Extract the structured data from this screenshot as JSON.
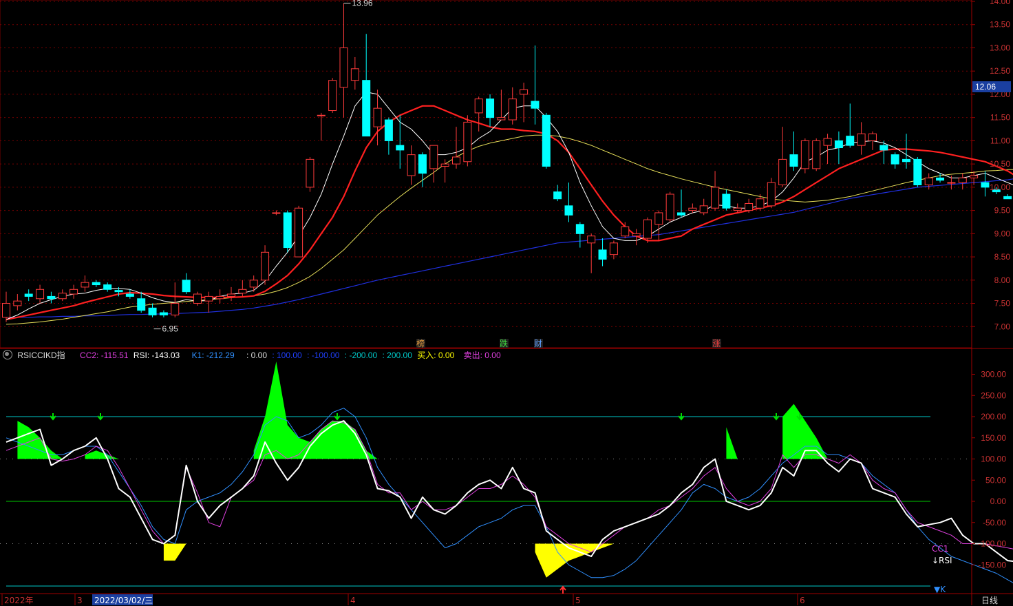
{
  "colors": {
    "bg": "#000000",
    "up": "#ff3b3b",
    "down": "#00ffff",
    "ma5": "#ffffff",
    "ma10": "#ff2020",
    "ma20": "#e8e05a",
    "ma60": "#2030e0",
    "grid": "#7a0000",
    "axis_text": "#c83232",
    "cc1_fill": "#00ff00",
    "cc1_fill_neg": "#ffff00",
    "cyan_line": "#00c8c8",
    "green_line": "#00c800",
    "magenta": "#e040e0",
    "blue_k": "#3090ff"
  },
  "price_axis": [
    "14.00",
    "13.50",
    "13.00",
    "12.50",
    "12.00",
    "11.50",
    "11.00",
    "10.50",
    "10.00",
    "9.50",
    "9.00",
    "8.50",
    "8.00",
    "7.50",
    "7.00"
  ],
  "current_price": "12.06",
  "high_label": "13.96",
  "low_label": "6.95",
  "indicator_axis": [
    "300.00",
    "250.00",
    "200.00",
    "150.00",
    "100.00",
    "50.00",
    "0.00",
    "-50.00",
    "-100.00",
    "-150.00"
  ],
  "indicator_header": {
    "name": "RSICCIKD指",
    "cc2": "CC2: -115.51",
    "rsi": "RSI: -143.03",
    "k1": "K1: -212.29",
    "v0": ": 0.00",
    "v100": ": 100.00",
    "vm100": ": -100.00",
    "vm200": ": -200.00",
    "v200": ": 200.00",
    "buy": "买入: 0.00",
    "sell": "卖出: 0.00"
  },
  "series_labels": {
    "cc1": "CC1",
    "rsi": "↓RSI",
    "k": "▼K"
  },
  "event_markers": [
    {
      "text": "榜",
      "color": "#e8a040"
    },
    {
      "text": "跌",
      "color": "#40e040"
    },
    {
      "text": "财",
      "color": "#60a0ff"
    },
    {
      "text": "涨",
      "color": "#ff4040"
    }
  ],
  "time_axis": {
    "labels": [
      "2022年",
      "3",
      "4",
      "5",
      "6"
    ],
    "cursor_date": "2022/03/02/三",
    "period": "日线"
  },
  "chart_data": {
    "type": "candlestick",
    "x_range": [
      "2022年",
      "6"
    ],
    "ylim": [
      6.9,
      14.0
    ],
    "candles": [
      [
        7.2,
        7.5,
        7.75,
        7.1
      ],
      [
        7.45,
        7.55,
        7.7,
        7.35
      ],
      [
        7.7,
        7.65,
        7.8,
        7.55
      ],
      [
        7.6,
        7.8,
        7.9,
        7.5
      ],
      [
        7.65,
        7.6,
        7.75,
        7.5
      ],
      [
        7.6,
        7.72,
        7.8,
        7.55
      ],
      [
        7.7,
        7.8,
        7.9,
        7.6
      ],
      [
        7.85,
        7.95,
        8.1,
        7.75
      ],
      [
        7.95,
        7.9,
        8.0,
        7.85
      ],
      [
        7.9,
        7.8,
        7.95,
        7.75
      ],
      [
        7.78,
        7.75,
        7.85,
        7.65
      ],
      [
        7.7,
        7.65,
        7.8,
        7.6
      ],
      [
        7.6,
        7.35,
        7.75,
        7.3
      ],
      [
        7.4,
        7.25,
        7.5,
        7.2
      ],
      [
        7.3,
        7.25,
        7.35,
        7.2
      ],
      [
        7.25,
        7.5,
        7.95,
        7.2
      ],
      [
        8.0,
        7.75,
        8.15,
        7.7
      ],
      [
        7.5,
        7.7,
        7.75,
        7.45
      ],
      [
        7.55,
        7.65,
        7.75,
        7.3
      ],
      [
        7.6,
        7.65,
        7.8,
        7.5
      ],
      [
        7.65,
        7.7,
        7.85,
        7.55
      ],
      [
        7.72,
        7.8,
        8.0,
        7.65
      ],
      [
        7.85,
        8.0,
        8.1,
        7.75
      ],
      [
        8.0,
        8.6,
        8.75,
        7.9
      ],
      [
        9.45,
        9.45,
        9.5,
        9.4
      ],
      [
        9.45,
        8.7,
        9.5,
        8.6
      ],
      [
        8.5,
        9.55,
        9.6,
        8.5
      ],
      [
        10.0,
        10.6,
        10.65,
        9.9
      ],
      [
        11.55,
        11.55,
        11.6,
        11.0
      ],
      [
        11.65,
        12.3,
        12.35,
        11.6
      ],
      [
        12.15,
        13.0,
        13.96,
        11.5
      ],
      [
        12.3,
        12.55,
        12.8,
        12.1
      ],
      [
        12.3,
        11.1,
        13.3,
        11.1
      ],
      [
        11.3,
        11.7,
        12.1,
        10.9
      ],
      [
        11.45,
        11.0,
        11.5,
        10.7
      ],
      [
        10.9,
        10.8,
        11.55,
        10.4
      ],
      [
        10.25,
        10.7,
        10.9,
        10.05
      ],
      [
        10.7,
        10.3,
        10.75,
        10.0
      ],
      [
        10.4,
        10.9,
        10.9,
        10.1
      ],
      [
        10.45,
        10.5,
        10.6,
        10.1
      ],
      [
        10.5,
        10.65,
        11.3,
        10.4
      ],
      [
        10.55,
        11.4,
        11.55,
        10.45
      ],
      [
        11.6,
        11.9,
        11.95,
        11.2
      ],
      [
        11.9,
        11.5,
        12.0,
        11.3
      ],
      [
        11.45,
        11.5,
        12.1,
        11.45
      ],
      [
        11.45,
        11.9,
        12.15,
        11.35
      ],
      [
        12.0,
        12.1,
        12.25,
        11.4
      ],
      [
        11.85,
        11.7,
        13.05,
        11.35
      ],
      [
        11.55,
        10.45,
        11.6,
        10.4
      ],
      [
        9.9,
        9.75,
        10.05,
        9.7
      ],
      [
        9.6,
        9.4,
        10.1,
        9.25
      ],
      [
        9.2,
        9.0,
        9.25,
        8.7
      ],
      [
        8.8,
        8.95,
        9.0,
        8.15
      ],
      [
        8.65,
        8.45,
        8.9,
        8.3
      ],
      [
        8.55,
        8.8,
        8.85,
        8.45
      ],
      [
        8.95,
        9.15,
        9.25,
        8.9
      ],
      [
        8.95,
        9.0,
        9.1,
        8.75
      ],
      [
        8.9,
        9.3,
        9.35,
        8.8
      ],
      [
        9.2,
        9.45,
        9.5,
        8.85
      ],
      [
        9.3,
        9.85,
        9.9,
        9.25
      ],
      [
        9.45,
        9.4,
        9.95,
        9.35
      ],
      [
        9.5,
        9.55,
        9.65,
        9.45
      ],
      [
        9.45,
        9.6,
        9.75,
        9.4
      ],
      [
        9.55,
        10.0,
        10.35,
        9.5
      ],
      [
        9.85,
        9.55,
        9.95,
        9.5
      ],
      [
        9.5,
        9.55,
        9.65,
        9.45
      ],
      [
        9.5,
        9.65,
        9.75,
        9.45
      ],
      [
        9.55,
        9.75,
        9.85,
        9.5
      ],
      [
        9.6,
        10.1,
        10.2,
        9.55
      ],
      [
        10.05,
        10.6,
        11.3,
        10.0
      ],
      [
        10.7,
        10.45,
        11.2,
        10.35
      ],
      [
        10.4,
        11.0,
        11.05,
        10.3
      ],
      [
        10.4,
        11.0,
        11.05,
        10.35
      ],
      [
        10.9,
        11.05,
        11.15,
        10.5
      ],
      [
        11.0,
        10.85,
        11.2,
        10.5
      ],
      [
        11.1,
        10.9,
        11.8,
        10.85
      ],
      [
        10.9,
        11.15,
        11.4,
        10.7
      ],
      [
        11.0,
        11.15,
        11.2,
        10.8
      ],
      [
        10.9,
        10.8,
        11.0,
        10.5
      ],
      [
        10.7,
        10.5,
        10.75,
        10.4
      ],
      [
        10.6,
        10.55,
        11.15,
        10.4
      ],
      [
        10.6,
        10.05,
        10.65,
        10.0
      ],
      [
        10.05,
        10.2,
        10.3,
        9.95
      ],
      [
        10.2,
        10.15,
        10.3,
        10.1
      ],
      [
        10.1,
        10.1,
        10.25,
        9.95
      ],
      [
        10.1,
        10.2,
        10.3,
        9.95
      ],
      [
        10.2,
        10.25,
        10.35,
        10.05
      ],
      [
        10.1,
        10.0,
        10.35,
        9.8
      ],
      [
        9.95,
        9.9,
        10.0,
        9.85
      ],
      [
        9.8,
        9.75,
        9.85,
        9.75
      ],
      [
        9.75,
        9.75,
        9.85,
        9.7
      ],
      [
        9.75,
        9.6,
        9.8,
        9.6
      ]
    ],
    "ma5": [
      7.15,
      7.25,
      7.38,
      7.5,
      7.58,
      7.65,
      7.7,
      7.72,
      7.78,
      7.82,
      7.82,
      7.8,
      7.72,
      7.62,
      7.55,
      7.52,
      7.58,
      7.55,
      7.56,
      7.65,
      7.7,
      7.72,
      7.78,
      7.98,
      8.3,
      8.6,
      8.95,
      9.35,
      9.85,
      10.5,
      11.1,
      11.75,
      12.05,
      12.0,
      11.7,
      11.4,
      11.25,
      11.0,
      10.7,
      10.7,
      10.75,
      10.85,
      11.05,
      11.2,
      11.45,
      11.7,
      11.75,
      11.75,
      11.5,
      11.2,
      10.75,
      10.1,
      9.6,
      9.15,
      8.9,
      8.85,
      8.85,
      8.95,
      9.1,
      9.25,
      9.35,
      9.45,
      9.5,
      9.62,
      9.6,
      9.55,
      9.55,
      9.6,
      9.7,
      9.9,
      10.2,
      10.55,
      10.65,
      10.8,
      10.85,
      10.95,
      10.98,
      11.0,
      10.95,
      10.85,
      10.7,
      10.55,
      10.4,
      10.3,
      10.2,
      10.2,
      10.25,
      10.3,
      10.2,
      10.1,
      10.0,
      9.88
    ],
    "ma10": [
      7.15,
      7.2,
      7.25,
      7.3,
      7.35,
      7.4,
      7.45,
      7.52,
      7.58,
      7.64,
      7.7,
      7.73,
      7.72,
      7.7,
      7.67,
      7.65,
      7.64,
      7.63,
      7.63,
      7.63,
      7.63,
      7.64,
      7.66,
      7.76,
      7.92,
      8.1,
      8.35,
      8.65,
      9.0,
      9.35,
      9.8,
      10.35,
      10.85,
      11.2,
      11.4,
      11.55,
      11.65,
      11.75,
      11.75,
      11.65,
      11.55,
      11.45,
      11.38,
      11.3,
      11.25,
      11.25,
      11.22,
      11.2,
      11.15,
      11.0,
      10.75,
      10.4,
      10.05,
      9.7,
      9.4,
      9.15,
      8.95,
      8.85,
      8.85,
      8.9,
      8.95,
      9.1,
      9.2,
      9.3,
      9.4,
      9.45,
      9.5,
      9.55,
      9.6,
      9.68,
      9.8,
      9.95,
      10.1,
      10.25,
      10.4,
      10.5,
      10.6,
      10.7,
      10.8,
      10.82,
      10.82,
      10.8,
      10.78,
      10.75,
      10.7,
      10.65,
      10.6,
      10.55,
      10.45,
      10.35,
      10.2,
      10.05
    ],
    "ma20": [
      7.05,
      7.06,
      7.08,
      7.1,
      7.13,
      7.16,
      7.2,
      7.24,
      7.28,
      7.32,
      7.37,
      7.42,
      7.45,
      7.48,
      7.5,
      7.52,
      7.54,
      7.56,
      7.58,
      7.6,
      7.62,
      7.64,
      7.66,
      7.7,
      7.76,
      7.84,
      7.95,
      8.08,
      8.25,
      8.45,
      8.65,
      8.9,
      9.15,
      9.4,
      9.6,
      9.8,
      9.98,
      10.15,
      10.32,
      10.5,
      10.65,
      10.78,
      10.88,
      10.95,
      11.0,
      11.05,
      11.1,
      11.12,
      11.12,
      11.1,
      11.05,
      10.98,
      10.9,
      10.8,
      10.7,
      10.6,
      10.5,
      10.4,
      10.32,
      10.25,
      10.18,
      10.12,
      10.06,
      10.0,
      9.95,
      9.9,
      9.85,
      9.8,
      9.75,
      9.72,
      9.7,
      9.68,
      9.7,
      9.72,
      9.76,
      9.8,
      9.86,
      9.92,
      9.98,
      10.04,
      10.1,
      10.15,
      10.2,
      10.25,
      10.28,
      10.3,
      10.32,
      10.35,
      10.36,
      10.38,
      10.38,
      10.38
    ],
    "ma60": [
      7.2,
      7.2,
      7.2,
      7.21,
      7.21,
      7.22,
      7.22,
      7.23,
      7.23,
      7.24,
      7.25,
      7.26,
      7.26,
      7.27,
      7.27,
      7.28,
      7.29,
      7.3,
      7.31,
      7.33,
      7.35,
      7.37,
      7.4,
      7.44,
      7.48,
      7.53,
      7.58,
      7.64,
      7.7,
      7.76,
      7.82,
      7.88,
      7.94,
      8.0,
      8.05,
      8.1,
      8.15,
      8.2,
      8.25,
      8.3,
      8.35,
      8.4,
      8.45,
      8.5,
      8.55,
      8.6,
      8.65,
      8.7,
      8.75,
      8.8,
      8.82,
      8.84,
      8.86,
      8.88,
      8.9,
      8.92,
      8.94,
      8.96,
      8.98,
      9.02,
      9.06,
      9.1,
      9.14,
      9.18,
      9.22,
      9.26,
      9.3,
      9.34,
      9.38,
      9.42,
      9.46,
      9.52,
      9.58,
      9.64,
      9.7,
      9.76,
      9.8,
      9.84,
      9.88,
      9.92,
      9.96,
      10.0,
      10.02,
      10.04,
      10.06,
      10.08,
      10.1,
      10.12,
      10.14,
      10.16,
      10.2,
      10.24
    ],
    "indicator": {
      "ylim": [
        -205,
        320
      ],
      "cc1": [
        100,
        190,
        175,
        150,
        120,
        90,
        100,
        110,
        120,
        110,
        100,
        60,
        0,
        -70,
        -140,
        -140,
        -60,
        0,
        30,
        50,
        80,
        100,
        120,
        200,
        330,
        180,
        150,
        140,
        170,
        190,
        190,
        170,
        120,
        80,
        40,
        0,
        -60,
        -70,
        -80,
        -90,
        -70,
        -60,
        -50,
        -30,
        -10,
        -30,
        -60,
        -120,
        -180,
        -160,
        -140,
        -130,
        -120,
        -110,
        -100,
        -90,
        -70,
        -50,
        -30,
        -20,
        0,
        30,
        60,
        100,
        175,
        100,
        60,
        70,
        100,
        200,
        230,
        190,
        150,
        100,
        100,
        100,
        100,
        95,
        100,
        100,
        50,
        30,
        0,
        -30,
        -60,
        -80,
        -100,
        -100,
        -100,
        -100,
        -100,
        -100
      ],
      "rsi": [
        140,
        150,
        160,
        170,
        85,
        100,
        120,
        130,
        150,
        100,
        30,
        10,
        -40,
        -90,
        -100,
        -80,
        85,
        0,
        -40,
        -10,
        10,
        30,
        60,
        140,
        90,
        50,
        80,
        130,
        160,
        180,
        190,
        160,
        110,
        30,
        25,
        10,
        -40,
        10,
        -20,
        -30,
        -10,
        20,
        40,
        50,
        30,
        80,
        30,
        20,
        -70,
        -90,
        -110,
        -120,
        -130,
        -90,
        -70,
        -60,
        -50,
        -40,
        -30,
        -10,
        20,
        40,
        80,
        100,
        0,
        -10,
        -20,
        -10,
        20,
        80,
        60,
        120,
        120,
        90,
        70,
        100,
        90,
        30,
        20,
        10,
        -30,
        -60,
        -55,
        -50,
        -40,
        -80,
        -100,
        -100,
        -120,
        -140,
        -143
      ],
      "cc2": [
        120,
        130,
        140,
        150,
        100,
        95,
        100,
        110,
        130,
        120,
        80,
        30,
        -20,
        -70,
        -100,
        -80,
        80,
        20,
        -50,
        -60,
        10,
        30,
        50,
        110,
        120,
        100,
        110,
        140,
        170,
        190,
        185,
        170,
        120,
        40,
        20,
        20,
        -20,
        0,
        -20,
        -20,
        -10,
        10,
        30,
        30,
        40,
        60,
        40,
        10,
        -60,
        -80,
        -100,
        -110,
        -120,
        -100,
        -80,
        -60,
        -50,
        -40,
        -20,
        -10,
        10,
        30,
        60,
        80,
        30,
        0,
        -10,
        0,
        30,
        110,
        80,
        110,
        110,
        100,
        90,
        110,
        90,
        50,
        30,
        20,
        -20,
        -50,
        -60,
        -70,
        -80,
        -100,
        -100,
        -100,
        -105,
        -110,
        -115
      ],
      "k": [
        150,
        140,
        130,
        120,
        110,
        110,
        120,
        130,
        130,
        110,
        70,
        30,
        -10,
        -60,
        -90,
        -100,
        -20,
        0,
        10,
        20,
        40,
        70,
        110,
        180,
        200,
        190,
        150,
        160,
        180,
        210,
        220,
        200,
        150,
        80,
        40,
        10,
        -20,
        -50,
        -80,
        -110,
        -100,
        -80,
        -60,
        -50,
        -40,
        -20,
        -10,
        -10,
        -60,
        -120,
        -150,
        -165,
        -180,
        -180,
        -175,
        -160,
        -140,
        -110,
        -80,
        -50,
        -20,
        20,
        40,
        30,
        10,
        0,
        10,
        30,
        60,
        90,
        110,
        130,
        130,
        110,
        110,
        100,
        90,
        60,
        40,
        20,
        -20,
        -60,
        -90,
        -110,
        -130,
        -140,
        -150,
        -160,
        -170,
        -185,
        -200,
        -212
      ]
    }
  }
}
